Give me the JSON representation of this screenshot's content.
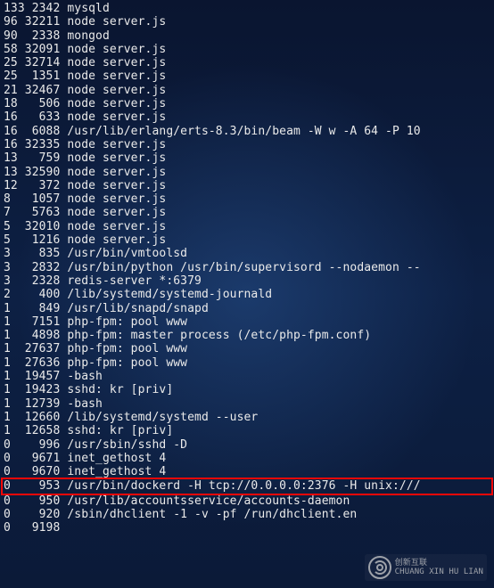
{
  "rows": [
    {
      "c1": "133",
      "c2": " 2342",
      "cmd": "mysqld"
    },
    {
      "c1": "96",
      "c2": "32211",
      "cmd": "node server.js"
    },
    {
      "c1": "90",
      "c2": " 2338",
      "cmd": "mongod"
    },
    {
      "c1": "58",
      "c2": "32091",
      "cmd": "node server.js"
    },
    {
      "c1": "25",
      "c2": "32714",
      "cmd": "node server.js"
    },
    {
      "c1": "25",
      "c2": " 1351",
      "cmd": "node server.js"
    },
    {
      "c1": "21",
      "c2": "32467",
      "cmd": "node server.js"
    },
    {
      "c1": "18",
      "c2": "  506",
      "cmd": "node server.js"
    },
    {
      "c1": "16",
      "c2": "  633",
      "cmd": "node server.js"
    },
    {
      "c1": "16",
      "c2": " 6088",
      "cmd": "/usr/lib/erlang/erts-8.3/bin/beam -W w -A 64 -P 10"
    },
    {
      "c1": "16",
      "c2": "32335",
      "cmd": "node server.js"
    },
    {
      "c1": "13",
      "c2": "  759",
      "cmd": "node server.js"
    },
    {
      "c1": "13",
      "c2": "32590",
      "cmd": "node server.js"
    },
    {
      "c1": "12",
      "c2": "  372",
      "cmd": "node server.js"
    },
    {
      "c1": "8",
      "c2": " 1057",
      "cmd": "node server.js"
    },
    {
      "c1": "7",
      "c2": " 5763",
      "cmd": "node server.js"
    },
    {
      "c1": "5",
      "c2": "32010",
      "cmd": "node server.js"
    },
    {
      "c1": "5",
      "c2": " 1216",
      "cmd": "node server.js"
    },
    {
      "c1": "3",
      "c2": "  835",
      "cmd": "/usr/bin/vmtoolsd"
    },
    {
      "c1": "3",
      "c2": " 2832",
      "cmd": "/usr/bin/python /usr/bin/supervisord --nodaemon --"
    },
    {
      "c1": "3",
      "c2": " 2328",
      "cmd": "redis-server *:6379"
    },
    {
      "c1": "2",
      "c2": "  400",
      "cmd": "/lib/systemd/systemd-journald"
    },
    {
      "c1": "1",
      "c2": "  849",
      "cmd": "/usr/lib/snapd/snapd"
    },
    {
      "c1": "1",
      "c2": " 7151",
      "cmd": "php-fpm: pool www"
    },
    {
      "c1": "1",
      "c2": " 4898",
      "cmd": "php-fpm: master process (/etc/php-fpm.conf)"
    },
    {
      "c1": "1",
      "c2": "27637",
      "cmd": "php-fpm: pool www"
    },
    {
      "c1": "1",
      "c2": "27636",
      "cmd": "php-fpm: pool www"
    },
    {
      "c1": "1",
      "c2": "19457",
      "cmd": "-bash"
    },
    {
      "c1": "1",
      "c2": "19423",
      "cmd": "sshd: kr [priv]"
    },
    {
      "c1": "1",
      "c2": "12739",
      "cmd": "-bash"
    },
    {
      "c1": "1",
      "c2": "12660",
      "cmd": "/lib/systemd/systemd --user"
    },
    {
      "c1": "1",
      "c2": "12658",
      "cmd": "sshd: kr [priv]"
    },
    {
      "c1": "0",
      "c2": "  996",
      "cmd": "/usr/sbin/sshd -D"
    },
    {
      "c1": "0",
      "c2": " 9671",
      "cmd": "inet_gethost 4"
    },
    {
      "c1": "0",
      "c2": " 9670",
      "cmd": "inet_gethost 4"
    },
    {
      "c1": "0",
      "c2": "  953",
      "cmd": "/usr/bin/dockerd -H tcp://0.0.0.0:2376 -H unix:///",
      "hl": true
    },
    {
      "c1": "0",
      "c2": "  950",
      "cmd": "/usr/lib/accountsservice/accounts-daemon"
    },
    {
      "c1": "0",
      "c2": "  920",
      "cmd": "/sbin/dhclient -1 -v -pf /run/dhclient.en"
    },
    {
      "c1": "0",
      "c2": " 9198",
      "cmd": ""
    }
  ],
  "watermark": {
    "brand": "创新互联",
    "sub": "CHUANG XIN HU LIAN"
  }
}
